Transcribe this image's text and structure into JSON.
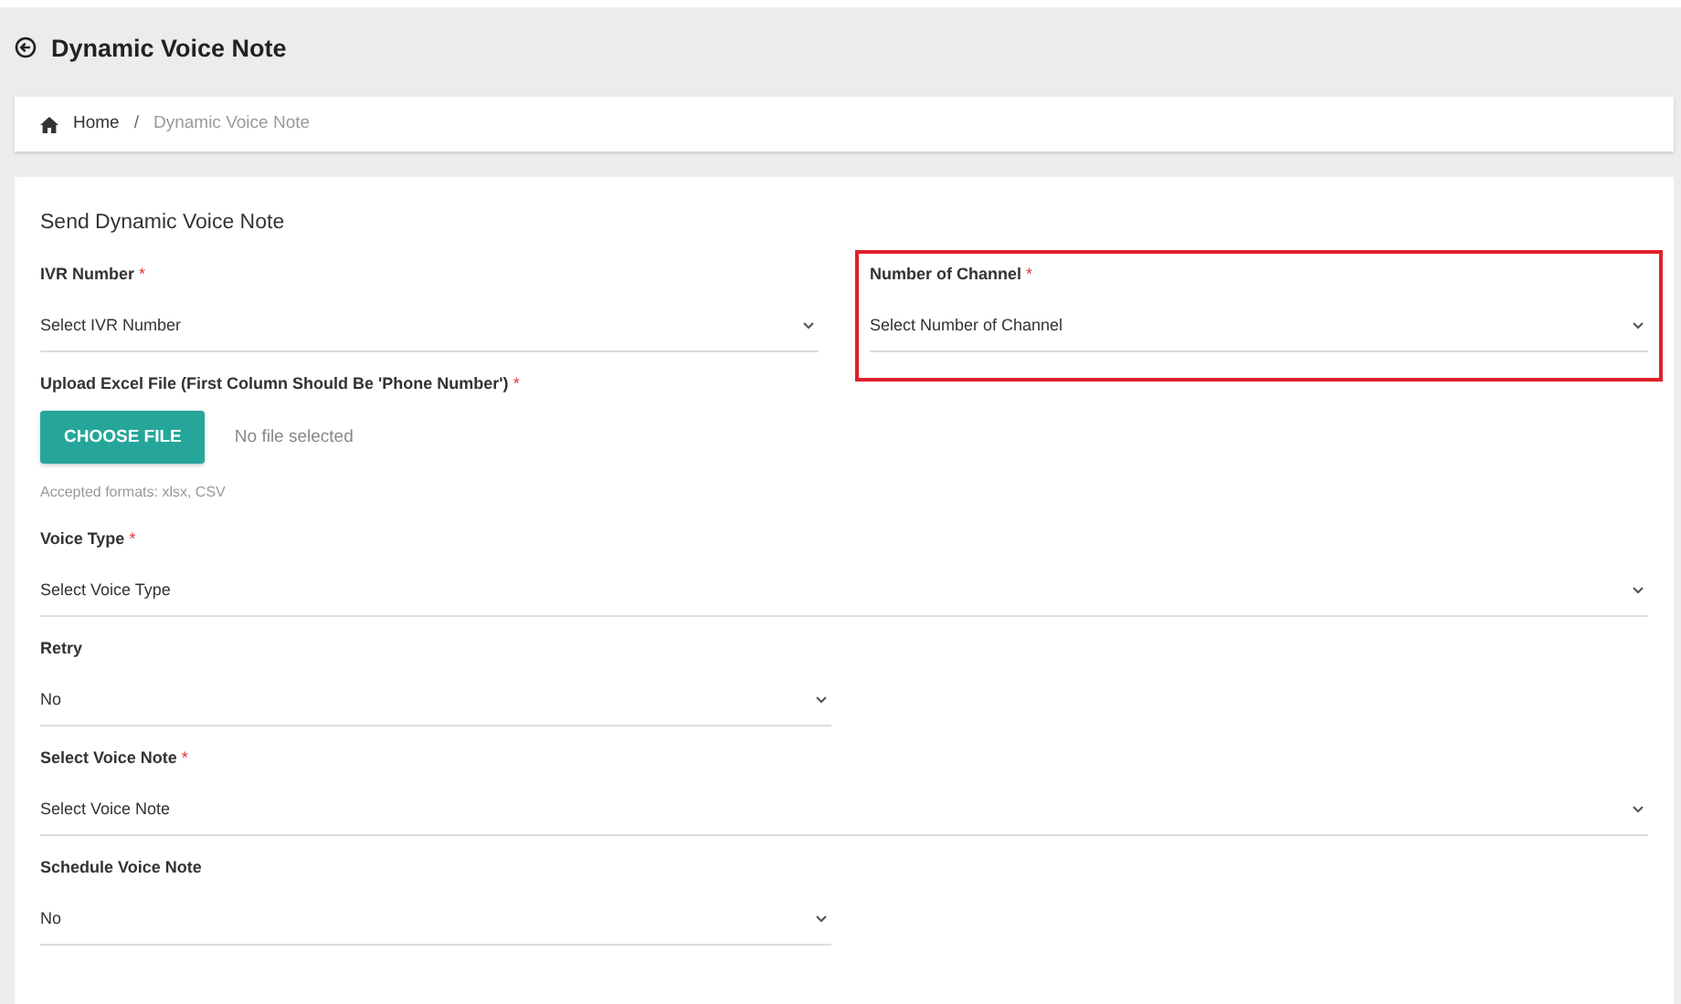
{
  "header": {
    "title": "Dynamic Voice Note"
  },
  "breadcrumb": [
    {
      "label": "Home",
      "active": false
    },
    {
      "label": "/",
      "kind": "separator"
    },
    {
      "label": "Dynamic Voice Note",
      "active": true
    }
  ],
  "form": {
    "title": "Send Dynamic Voice Note",
    "rows": [
      {
        "fields": [
          {
            "kind": "select",
            "label": "IVR Number",
            "required_mark": "*",
            "value": "Select IVR Number",
            "highlighted": false
          },
          {
            "kind": "select",
            "label": "Number of Channel",
            "required_mark": "*",
            "value": "Select Number of Channel",
            "highlighted": true
          }
        ]
      },
      {
        "fields": [
          {
            "kind": "file",
            "label": "Upload Excel File (First Column Should Be 'Phone Number')",
            "required_mark": "*",
            "button": "CHOOSE FILE",
            "status": "No file selected",
            "hint": "Accepted formats: xlsx, CSV"
          }
        ]
      },
      {
        "fields": [
          {
            "kind": "select",
            "wide": true,
            "label": "Voice Type",
            "required_mark": "*",
            "value": "Select Voice Type",
            "highlighted": false
          }
        ]
      },
      {
        "fields": [
          {
            "kind": "select",
            "wide": false,
            "label": "Retry",
            "value": "No",
            "highlighted": false
          }
        ]
      },
      {
        "fields": [
          {
            "kind": "select",
            "wide": true,
            "label": "Select Voice Note",
            "required_mark": "*",
            "value": "Select Voice Note",
            "highlighted": false
          }
        ]
      },
      {
        "fields": [
          {
            "kind": "select",
            "wide": false,
            "label": "Schedule Voice Note",
            "value": "No",
            "highlighted": false
          }
        ]
      }
    ]
  }
}
